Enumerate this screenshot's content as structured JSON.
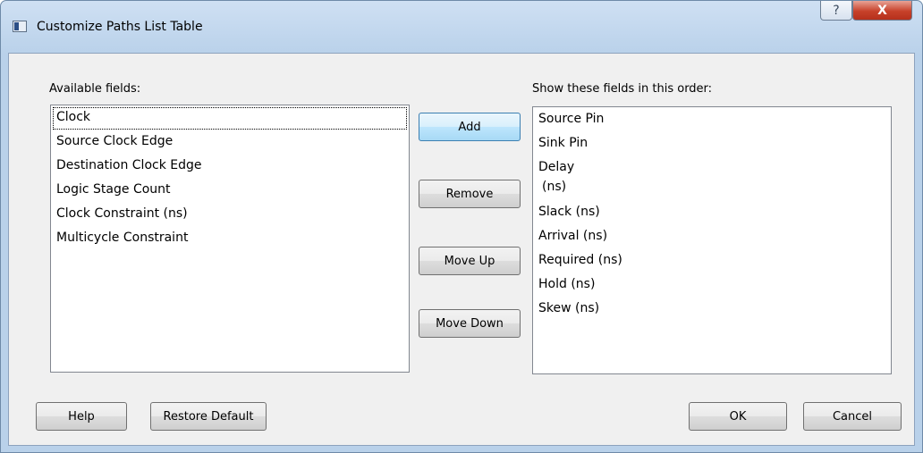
{
  "window": {
    "title": "Customize Paths List Table",
    "help_glyph": "?",
    "close_glyph": "X"
  },
  "available": {
    "label": "Available fields:",
    "items": [
      "Clock",
      "Source Clock Edge",
      "Destination Clock Edge",
      "Logic Stage Count",
      "Clock Constraint (ns)",
      "Multicycle Constraint"
    ]
  },
  "shown": {
    "label": "Show these fields in this order:",
    "items": [
      "Source Pin",
      "Sink Pin",
      [
        "Delay",
        "(ns)"
      ],
      "Slack (ns)",
      "Arrival (ns)",
      "Required (ns)",
      "Hold (ns)",
      "Skew (ns)"
    ]
  },
  "buttons": {
    "add": "Add",
    "remove": "Remove",
    "move_up": "Move Up",
    "move_down": "Move Down",
    "help": "Help",
    "restore_default": "Restore Default",
    "ok": "OK",
    "cancel": "Cancel"
  }
}
